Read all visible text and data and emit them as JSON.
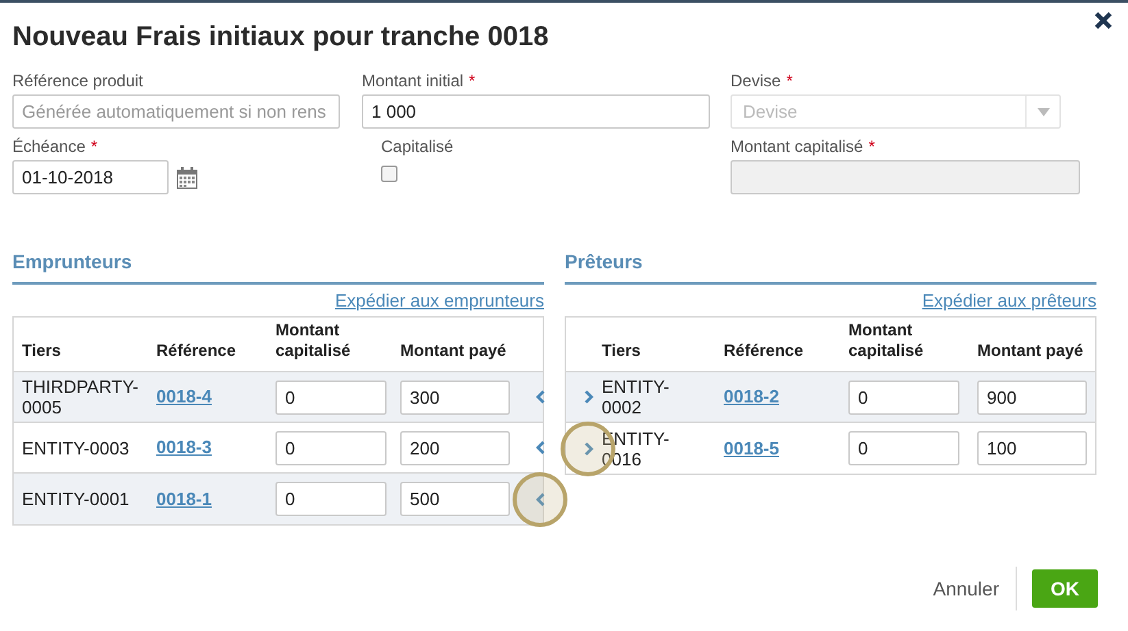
{
  "dialog": {
    "title": "Nouveau Frais initiaux pour tranche 0018"
  },
  "form": [
    {
      "label": "Référence produit",
      "kind": "text",
      "placeholder": "Générée automatiquement si non rens"
    },
    {
      "label": "Montant initial",
      "required_mark": "*",
      "kind": "text",
      "value": "1 000"
    },
    {
      "label": "Devise",
      "required_mark": "*",
      "kind": "select",
      "placeholder": "Devise",
      "disabled": true
    },
    {
      "label": "Échéance",
      "required_mark": "*",
      "kind": "date",
      "value": "01-10-2018"
    },
    {
      "label": "Capitalisé",
      "kind": "checkbox",
      "checked": false
    },
    {
      "label": "Montant capitalisé",
      "required_mark": "*",
      "kind": "text",
      "disabled": true
    }
  ],
  "tables": [
    {
      "kind": "borrowers",
      "title": "Emprunteurs",
      "link": "Expédier aux emprunteurs",
      "columns": [
        "Tiers",
        "Référence",
        "Montant capitalisé",
        "Montant payé"
      ],
      "rows": [
        {
          "tiers": "THIRDPARTY-0005",
          "reference": "0018-4",
          "montant_capitalise": "0",
          "montant_paye": "300",
          "highlighted": false
        },
        {
          "tiers": "ENTITY-0003",
          "reference": "0018-3",
          "montant_capitalise": "0",
          "montant_paye": "200",
          "highlighted": false
        },
        {
          "tiers": "ENTITY-0001",
          "reference": "0018-1",
          "montant_capitalise": "0",
          "montant_paye": "500",
          "highlighted": true
        }
      ]
    },
    {
      "kind": "lenders",
      "title": "Prêteurs",
      "link": "Expédier aux prêteurs",
      "columns": [
        "Tiers",
        "Référence",
        "Montant capitalisé",
        "Montant payé"
      ],
      "rows": [
        {
          "tiers": "ENTITY-0002",
          "reference": "0018-2",
          "montant_capitalise": "0",
          "montant_paye": "900",
          "highlighted": false
        },
        {
          "tiers": "ENTITY-0016",
          "reference": "0018-5",
          "montant_capitalise": "0",
          "montant_paye": "100",
          "highlighted": true
        }
      ]
    }
  ],
  "buttons": {
    "cancel": "Annuler",
    "ok": "OK"
  }
}
